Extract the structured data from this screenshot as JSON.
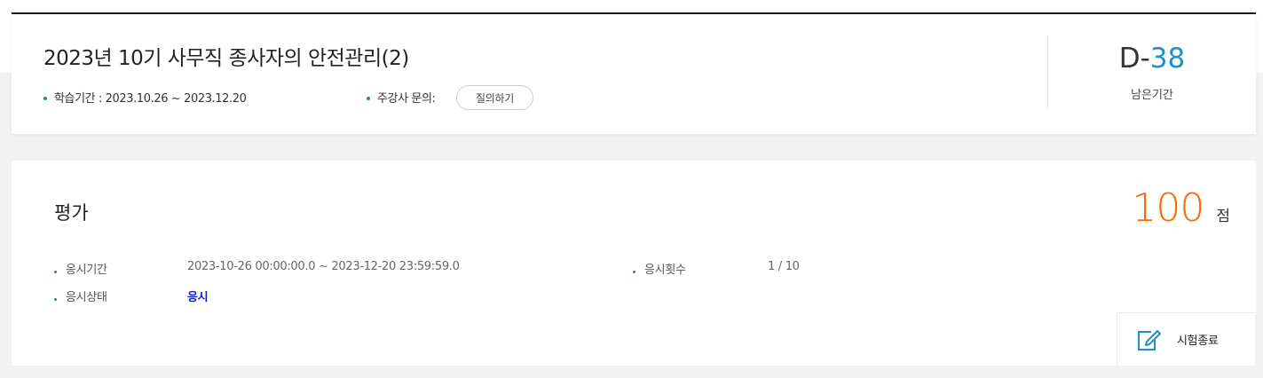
{
  "course": {
    "title": "2023년 10기 사무직 종사자의 안전관리(2)",
    "period_label": "학습기간 : 2023.10.26 ~ 2023.12.20",
    "inquiry_label": "주강사 문의:",
    "inquiry_button": "질의하기",
    "dday_prefix": "D-",
    "dday_value": "38",
    "dday_label": "남은기간"
  },
  "evaluation": {
    "title": "평가",
    "score": "100",
    "score_unit": "점",
    "exam_period_label": "응시기간",
    "exam_period_value": "2023-10-26 00:00:00.0 ~ 2023-12-20 23:59:59.0",
    "exam_status_label": "응시상태",
    "exam_status_value": "응시",
    "attempts_label": "응시횟수",
    "attempts_value": "1 / 10",
    "end_button": "시험종료",
    "end_icon": "edit-pencil-icon"
  },
  "colors": {
    "dday_accent": "#1f8fcf",
    "score": "#ff6a00",
    "status": "#1020c8",
    "bullet": "#1e9b45"
  }
}
